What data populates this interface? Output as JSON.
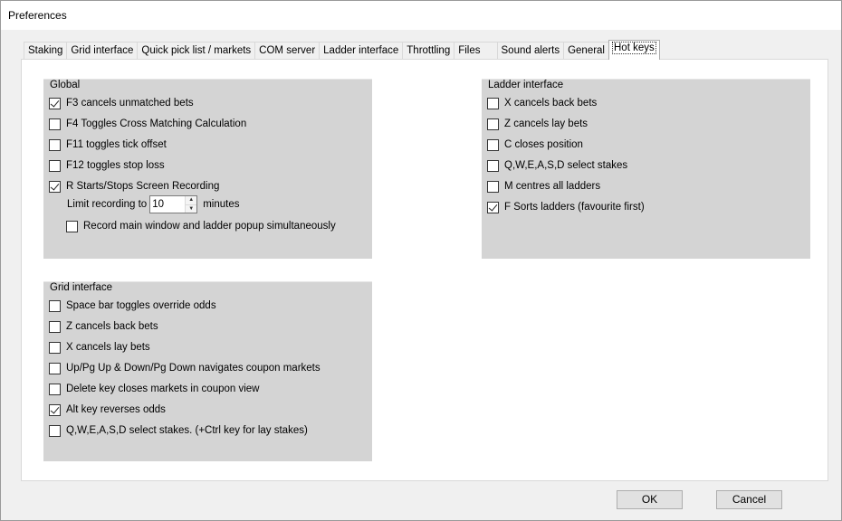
{
  "window": {
    "title": "Preferences"
  },
  "tabs": [
    {
      "label": "Staking",
      "active": false
    },
    {
      "label": "Grid interface",
      "active": false
    },
    {
      "label": "Quick pick list / markets",
      "active": false
    },
    {
      "label": "COM server",
      "active": false
    },
    {
      "label": "Ladder interface",
      "active": false
    },
    {
      "label": "Throttling",
      "active": false
    },
    {
      "label": "Files",
      "active": false
    },
    {
      "label": "Sound alerts",
      "active": false
    },
    {
      "label": "General",
      "active": false
    },
    {
      "label": "Hot keys",
      "active": true
    }
  ],
  "global": {
    "title": "Global",
    "items": [
      {
        "label": "F3 cancels unmatched bets",
        "checked": true
      },
      {
        "label": "F4 Toggles Cross Matching Calculation",
        "checked": false
      },
      {
        "label": "F11 toggles tick offset",
        "checked": false
      },
      {
        "label": "F12 toggles stop loss",
        "checked": false
      },
      {
        "label": "R Starts/Stops Screen Recording",
        "checked": true
      }
    ],
    "limit_label": "Limit recording to",
    "limit_value": "10",
    "limit_unit": "minutes",
    "record_both": {
      "label": "Record main window and ladder popup simultaneously",
      "checked": false
    }
  },
  "ladder": {
    "title": "Ladder interface",
    "items": [
      {
        "label": "X cancels back bets",
        "checked": false
      },
      {
        "label": "Z cancels lay bets",
        "checked": false
      },
      {
        "label": "C closes position",
        "checked": false
      },
      {
        "label": "Q,W,E,A,S,D select stakes",
        "checked": false
      },
      {
        "label": "M centres all ladders",
        "checked": false
      },
      {
        "label": "F Sorts ladders (favourite first)",
        "checked": true
      }
    ]
  },
  "grid": {
    "title": "Grid interface",
    "items": [
      {
        "label": "Space bar toggles override odds",
        "checked": false
      },
      {
        "label": "Z cancels back bets",
        "checked": false
      },
      {
        "label": "X cancels lay bets",
        "checked": false
      },
      {
        "label": "Up/Pg Up & Down/Pg Down navigates coupon markets",
        "checked": false
      },
      {
        "label": "Delete key closes markets in coupon view",
        "checked": false
      },
      {
        "label": "Alt key reverses odds",
        "checked": true
      },
      {
        "label": "Q,W,E,A,S,D select stakes. (+Ctrl key for lay stakes)",
        "checked": false
      }
    ]
  },
  "buttons": {
    "ok": "OK",
    "cancel": "Cancel"
  }
}
